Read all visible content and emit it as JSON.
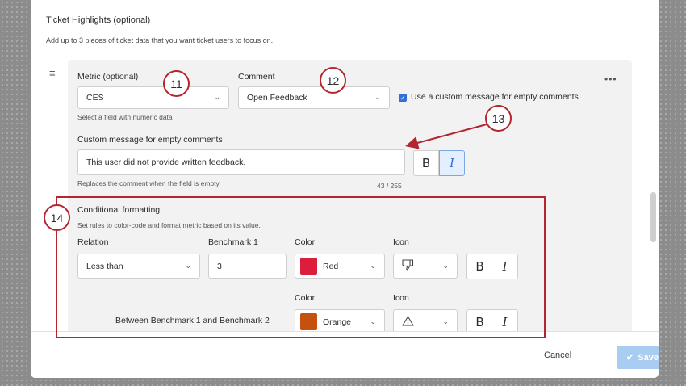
{
  "section": {
    "title": "Ticket Highlights (optional)",
    "description": "Add up to 3 pieces of ticket data that you want ticket users to focus on."
  },
  "metric": {
    "label": "Metric (optional)",
    "value": "CES",
    "hint": "Select a field with numeric data"
  },
  "comment": {
    "label": "Comment",
    "value": "Open Feedback",
    "checkbox_label": "Use a custom message for empty comments",
    "checkbox_checked": true
  },
  "custom_message": {
    "label": "Custom message for empty comments",
    "value": "This user did not provide written feedback.",
    "hint": "Replaces the comment when the field is empty",
    "counter": "43 / 255",
    "bold": "B",
    "italic": "I",
    "italic_active": true
  },
  "conditional": {
    "title": "Conditional formatting",
    "description": "Set rules to color-code and format metric based on its value.",
    "headers": {
      "relation": "Relation",
      "benchmark1": "Benchmark 1",
      "color": "Color",
      "icon": "Icon"
    },
    "rule1": {
      "relation": "Less than",
      "benchmark1": "3",
      "color_name": "Red",
      "color_hex": "#dc1e3d",
      "icon": "thumbs-down-icon",
      "bold": "B",
      "italic": "I"
    },
    "rule2": {
      "headers": {
        "color": "Color",
        "icon": "Icon"
      },
      "relation_text": "Between Benchmark 1 and Benchmark 2",
      "color_name": "Orange",
      "color_hex": "#c4510d",
      "icon": "warning-icon",
      "bold": "B",
      "italic": "I"
    }
  },
  "callouts": [
    "11",
    "12",
    "13",
    "14"
  ],
  "footer": {
    "cancel": "Cancel",
    "save": "Save"
  },
  "colors": {
    "accent": "#2f6fd6",
    "callout_red": "#b3252f",
    "save_disabled": "#a9cdf2"
  }
}
